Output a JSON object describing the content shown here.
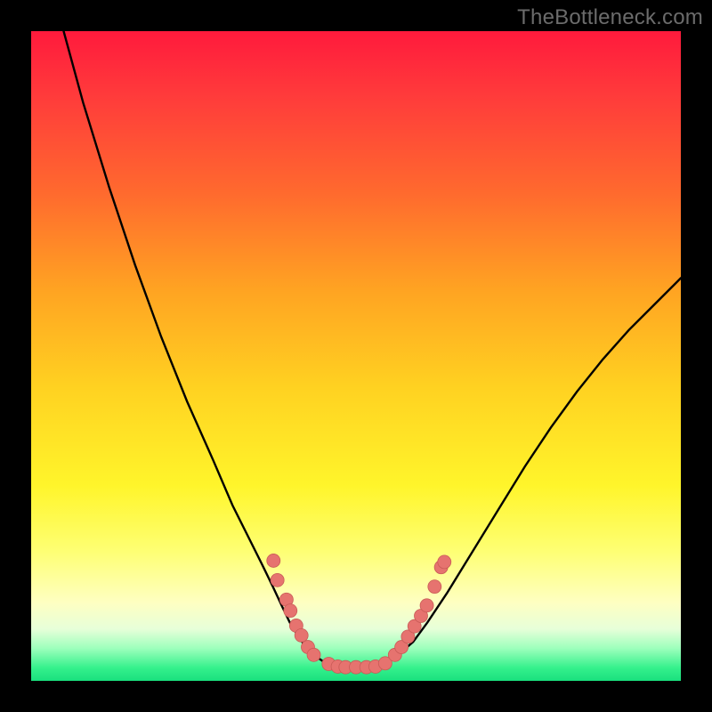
{
  "watermark": "TheBottleneck.com",
  "chart_data": {
    "type": "line",
    "title": "",
    "xlabel": "",
    "ylabel": "",
    "xlim": [
      0,
      100
    ],
    "ylim": [
      0,
      100
    ],
    "series": [
      {
        "name": "curve",
        "x": [
          5,
          8,
          12,
          16,
          20,
          24,
          28,
          31,
          33.5,
          35.5,
          37.2,
          38.6,
          39.8,
          41,
          42.4,
          43.2,
          45.5,
          48,
          50,
          52,
          54,
          56.5,
          58.8,
          61,
          64,
          68,
          72,
          76,
          80,
          84,
          88,
          92,
          96,
          100
        ],
        "y": [
          100,
          89,
          76,
          64,
          53,
          43,
          34,
          27,
          22,
          18,
          14.5,
          11.5,
          9,
          7,
          5,
          4.2,
          2.6,
          2.1,
          2.1,
          2.1,
          2.6,
          4,
          6,
          9,
          13.5,
          20,
          26.5,
          33,
          39,
          44.5,
          49.5,
          54,
          58,
          62
        ]
      }
    ],
    "scatter": [
      {
        "x": 37.3,
        "y": 18.5
      },
      {
        "x": 37.9,
        "y": 15.5
      },
      {
        "x": 39.3,
        "y": 12.5
      },
      {
        "x": 39.9,
        "y": 10.8
      },
      {
        "x": 40.8,
        "y": 8.5
      },
      {
        "x": 41.6,
        "y": 7.0
      },
      {
        "x": 42.6,
        "y": 5.2
      },
      {
        "x": 43.5,
        "y": 4.0
      },
      {
        "x": 45.8,
        "y": 2.6
      },
      {
        "x": 47.2,
        "y": 2.2
      },
      {
        "x": 48.4,
        "y": 2.1
      },
      {
        "x": 50.0,
        "y": 2.1
      },
      {
        "x": 51.6,
        "y": 2.1
      },
      {
        "x": 53.0,
        "y": 2.2
      },
      {
        "x": 54.5,
        "y": 2.7
      },
      {
        "x": 56.0,
        "y": 4.0
      },
      {
        "x": 57.0,
        "y": 5.2
      },
      {
        "x": 58.0,
        "y": 6.8
      },
      {
        "x": 59.0,
        "y": 8.4
      },
      {
        "x": 60.0,
        "y": 10.0
      },
      {
        "x": 60.9,
        "y": 11.6
      },
      {
        "x": 62.1,
        "y": 14.5
      },
      {
        "x": 63.1,
        "y": 17.5
      },
      {
        "x": 63.6,
        "y": 18.3
      }
    ],
    "background_gradient": {
      "top": "#ff1a3c",
      "bottom": "#19e07e"
    }
  }
}
